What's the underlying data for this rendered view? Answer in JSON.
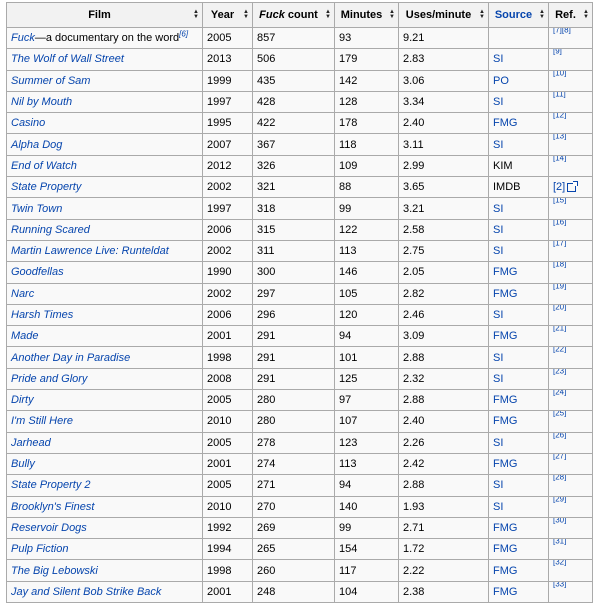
{
  "table": {
    "headers": {
      "film": "Film",
      "year": "Year",
      "count_prefix": "Fuck",
      "count_suffix": " count",
      "minutes": "Minutes",
      "uses_per_minute": "Uses/minute",
      "source": "Source",
      "ref": "Ref."
    },
    "rows": [
      {
        "film": "Fuck",
        "film_suffix": "—a documentary on the word",
        "film_sup": "[6]",
        "year": "2005",
        "count": "857",
        "minutes": "93",
        "upm": "9.21",
        "source": "",
        "ref": "[7][8]"
      },
      {
        "film": "The Wolf of Wall Street",
        "year": "2013",
        "count": "506",
        "minutes": "179",
        "upm": "2.83",
        "source": "SI",
        "ref": "[9]"
      },
      {
        "film": "Summer of Sam",
        "year": "1999",
        "count": "435",
        "minutes": "142",
        "upm": "3.06",
        "source": "PO",
        "ref": "[10]"
      },
      {
        "film": "Nil by Mouth",
        "year": "1997",
        "count": "428",
        "minutes": "128",
        "upm": "3.34",
        "source": "SI",
        "ref": "[11]"
      },
      {
        "film": "Casino",
        "year": "1995",
        "count": "422",
        "minutes": "178",
        "upm": "2.40",
        "source": "FMG",
        "ref": "[12]"
      },
      {
        "film": "Alpha Dog",
        "year": "2007",
        "count": "367",
        "minutes": "118",
        "upm": "3.11",
        "source": "SI",
        "ref": "[13]"
      },
      {
        "film": "End of Watch",
        "year": "2012",
        "count": "326",
        "minutes": "109",
        "upm": "2.99",
        "source": "KIM",
        "ref": "[14]"
      },
      {
        "film": "State Property",
        "year": "2002",
        "count": "321",
        "minutes": "88",
        "upm": "3.65",
        "source": "IMDB",
        "ref": "[2]"
      },
      {
        "film": "Twin Town",
        "year": "1997",
        "count": "318",
        "minutes": "99",
        "upm": "3.21",
        "source": "SI",
        "ref": "[15]"
      },
      {
        "film": "Running Scared",
        "year": "2006",
        "count": "315",
        "minutes": "122",
        "upm": "2.58",
        "source": "SI",
        "ref": "[16]"
      },
      {
        "film": "Martin Lawrence Live: Runteldat",
        "year": "2002",
        "count": "311",
        "minutes": "113",
        "upm": "2.75",
        "source": "SI",
        "ref": "[17]"
      },
      {
        "film": "Goodfellas",
        "year": "1990",
        "count": "300",
        "minutes": "146",
        "upm": "2.05",
        "source": "FMG",
        "ref": "[18]"
      },
      {
        "film": "Narc",
        "year": "2002",
        "count": "297",
        "minutes": "105",
        "upm": "2.82",
        "source": "FMG",
        "ref": "[19]"
      },
      {
        "film": "Harsh Times",
        "year": "2006",
        "count": "296",
        "minutes": "120",
        "upm": "2.46",
        "source": "SI",
        "ref": "[20]"
      },
      {
        "film": "Made",
        "year": "2001",
        "count": "291",
        "minutes": "94",
        "upm": "3.09",
        "source": "FMG",
        "ref": "[21]"
      },
      {
        "film": "Another Day in Paradise",
        "year": "1998",
        "count": "291",
        "minutes": "101",
        "upm": "2.88",
        "source": "SI",
        "ref": "[22]"
      },
      {
        "film": "Pride and Glory",
        "year": "2008",
        "count": "291",
        "minutes": "125",
        "upm": "2.32",
        "source": "SI",
        "ref": "[23]"
      },
      {
        "film": "Dirty",
        "year": "2005",
        "count": "280",
        "minutes": "97",
        "upm": "2.88",
        "source": "FMG",
        "ref": "[24]"
      },
      {
        "film": "I'm Still Here",
        "year": "2010",
        "count": "280",
        "minutes": "107",
        "upm": "2.40",
        "source": "FMG",
        "ref": "[25]"
      },
      {
        "film": "Jarhead",
        "year": "2005",
        "count": "278",
        "minutes": "123",
        "upm": "2.26",
        "source": "SI",
        "ref": "[26]"
      },
      {
        "film": "Bully",
        "year": "2001",
        "count": "274",
        "minutes": "113",
        "upm": "2.42",
        "source": "FMG",
        "ref": "[27]"
      },
      {
        "film": "State Property 2",
        "year": "2005",
        "count": "271",
        "minutes": "94",
        "upm": "2.88",
        "source": "SI",
        "ref": "[28]"
      },
      {
        "film": "Brooklyn's Finest",
        "year": "2010",
        "count": "270",
        "minutes": "140",
        "upm": "1.93",
        "source": "SI",
        "ref": "[29]"
      },
      {
        "film": "Reservoir Dogs",
        "year": "1992",
        "count": "269",
        "minutes": "99",
        "upm": "2.71",
        "source": "FMG",
        "ref": "[30]"
      },
      {
        "film": "Pulp Fiction",
        "year": "1994",
        "count": "265",
        "minutes": "154",
        "upm": "1.72",
        "source": "FMG",
        "ref": "[31]"
      },
      {
        "film": "The Big Lebowski",
        "year": "1998",
        "count": "260",
        "minutes": "117",
        "upm": "2.22",
        "source": "FMG",
        "ref": "[32]"
      },
      {
        "film": "Jay and Silent Bob Strike Back",
        "year": "2001",
        "count": "248",
        "minutes": "104",
        "upm": "2.38",
        "source": "FMG",
        "ref": "[33]"
      }
    ],
    "linked_sources": [
      "SI",
      "PO",
      "FMG"
    ],
    "sort_icon": "sort-arrows-icon",
    "external_link_icon": "external-link-icon"
  }
}
